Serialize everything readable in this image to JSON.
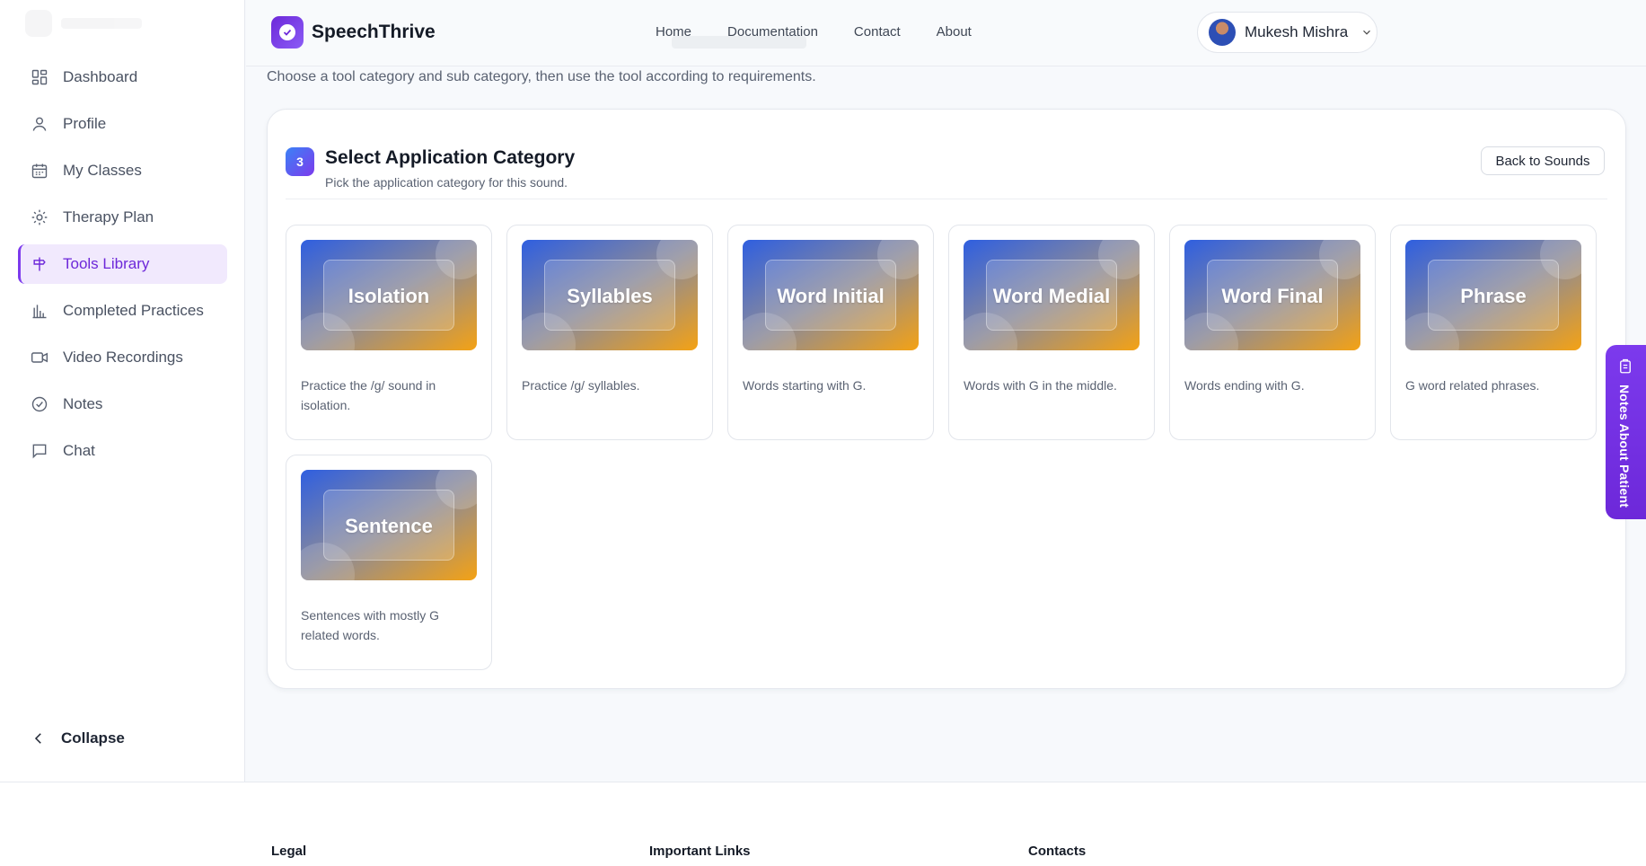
{
  "header": {
    "brand": "SpeechThrive",
    "nav": [
      "Home",
      "Documentation",
      "Contact",
      "About"
    ],
    "user_name": "Mukesh Mishra"
  },
  "sidebar": {
    "items": [
      {
        "label": "Dashboard",
        "icon": "dashboard-icon"
      },
      {
        "label": "Profile",
        "icon": "user-icon"
      },
      {
        "label": "My Classes",
        "icon": "calendar-icon"
      },
      {
        "label": "Therapy Plan",
        "icon": "sun-icon"
      },
      {
        "label": "Tools Library",
        "icon": "signpost-icon",
        "active": true
      },
      {
        "label": "Completed Practices",
        "icon": "bar-chart-icon"
      },
      {
        "label": "Video Recordings",
        "icon": "video-icon"
      },
      {
        "label": "Notes",
        "icon": "check-circle-icon"
      },
      {
        "label": "Chat",
        "icon": "message-icon"
      }
    ],
    "collapse_label": "Collapse"
  },
  "main": {
    "subtitle": "Choose a tool category and sub category, then use the tool according to requirements.",
    "step_number": "3",
    "title": "Select Application Category",
    "description": "Pick the application category for this sound.",
    "back_button": "Back to Sounds",
    "categories": [
      {
        "label": "Isolation",
        "text": "Practice the /g/ sound in isolation."
      },
      {
        "label": "Syllables",
        "text": "Practice /g/ syllables."
      },
      {
        "label": "Word Initial",
        "text": "Words starting with G."
      },
      {
        "label": "Word Medial",
        "text": "Words with G in the middle."
      },
      {
        "label": "Word Final",
        "text": "Words ending with G."
      },
      {
        "label": "Phrase",
        "text": "G word related phrases."
      },
      {
        "label": "Sentence",
        "text": "Sentences with mostly G related words."
      }
    ]
  },
  "notes_tab": {
    "label": "Notes About Patient",
    "icon": "clipboard-icon"
  },
  "footer": {
    "columns": [
      "Legal",
      "Important Links",
      "Contacts"
    ]
  },
  "colors": {
    "accent": "#7c3aed",
    "active_bg": "#f1e9fd",
    "banner_start": "#2f5fe0",
    "banner_end": "#f4a214"
  }
}
